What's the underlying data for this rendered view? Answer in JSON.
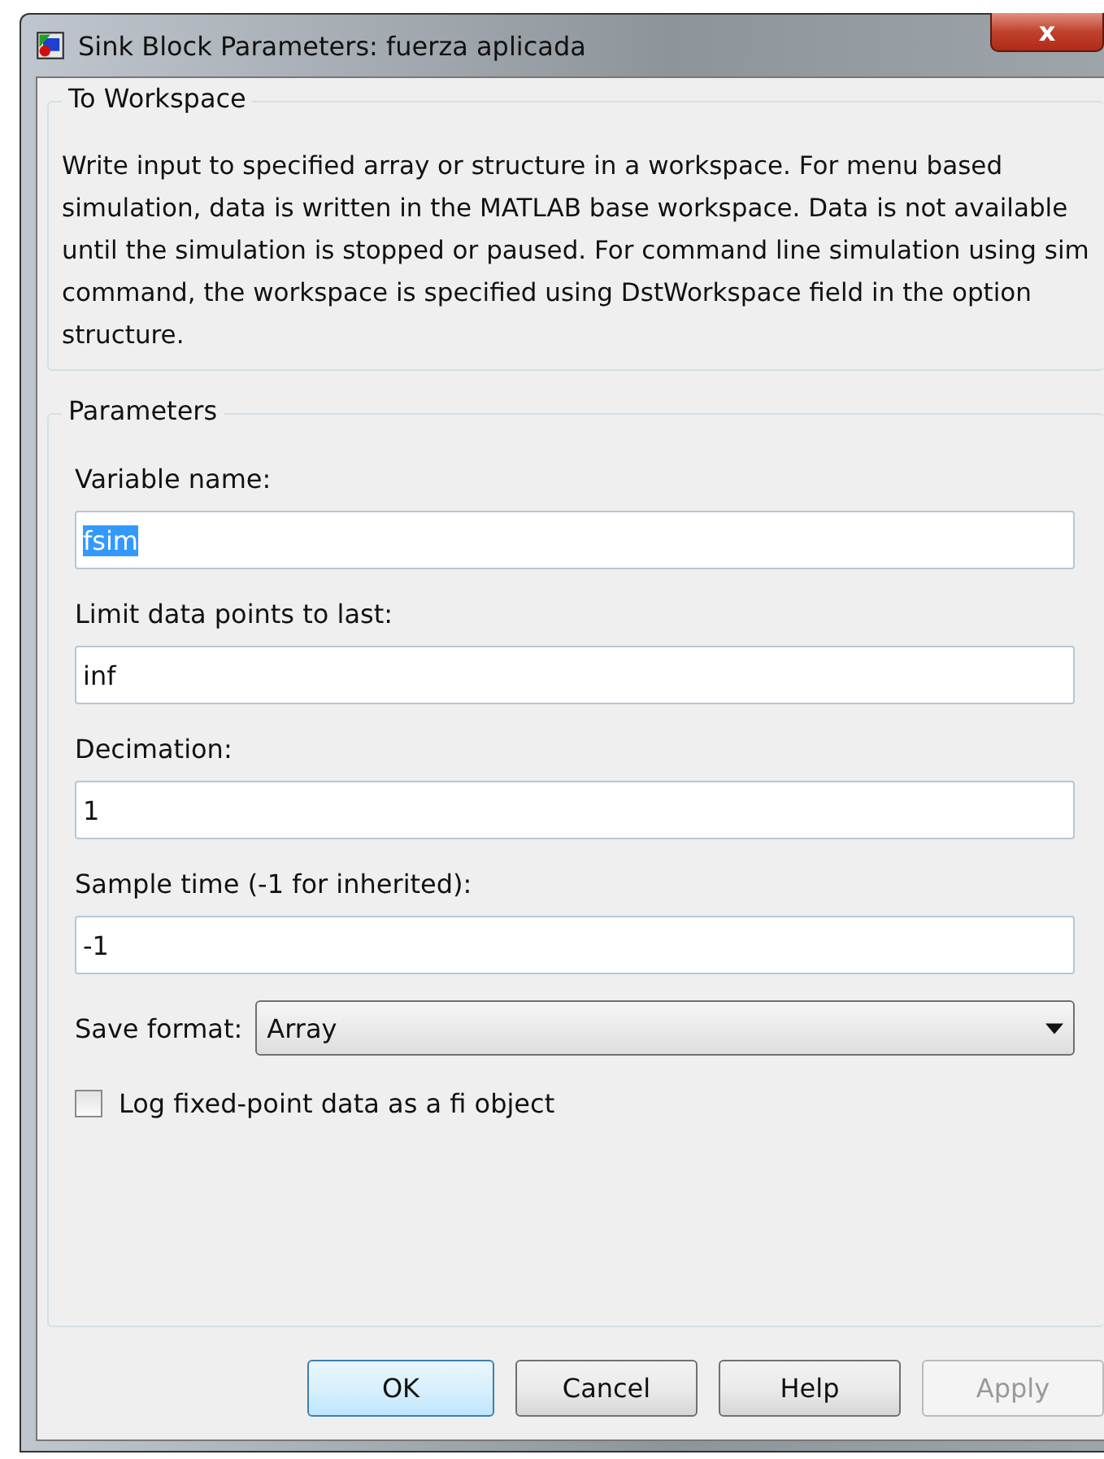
{
  "window": {
    "title": "Sink Block Parameters: fuerza aplicada",
    "close": "x"
  },
  "description_group": {
    "title": "To Workspace",
    "text": "Write input to specified array or structure in a workspace. For menu based simulation, data is written in the MATLAB base workspace. Data is not available until the simulation is stopped or paused. For command line simulation using sim command, the workspace is specified using DstWorkspace field in the option structure."
  },
  "parameters": {
    "title": "Parameters",
    "fields": [
      {
        "kind": "text",
        "label": "Variable name:",
        "value": "fsim",
        "highlighted": true
      },
      {
        "kind": "text",
        "label": "Limit data points to last:",
        "value": "inf",
        "highlighted": false
      },
      {
        "kind": "text",
        "label": "Decimation:",
        "value": "1",
        "highlighted": false
      },
      {
        "kind": "text",
        "label": "Sample time (-1 for inherited):",
        "value": "-1",
        "highlighted": false
      },
      {
        "kind": "dropdown",
        "label": "Save format:",
        "value": "Array",
        "highlighted": false
      },
      {
        "kind": "checkbox",
        "label": "Log fixed-point data as a fi object",
        "checked": false
      }
    ]
  },
  "buttons": [
    {
      "label": "OK",
      "default": true,
      "disabled": false
    },
    {
      "label": "Cancel",
      "default": false,
      "disabled": false
    },
    {
      "label": "Help",
      "default": false,
      "disabled": false
    },
    {
      "label": "Apply",
      "default": false,
      "disabled": true
    }
  ]
}
